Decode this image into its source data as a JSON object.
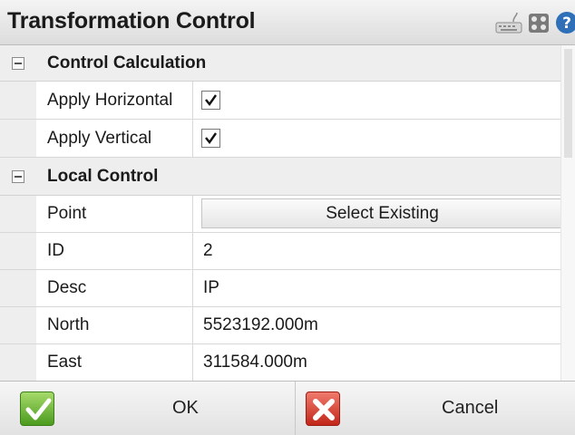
{
  "window": {
    "title": "Transformation Control",
    "icons": [
      "keyboard-icon",
      "grid-icon",
      "help-icon"
    ]
  },
  "sections": {
    "control_calculation": {
      "title": "Control Calculation",
      "apply_horizontal": {
        "label": "Apply Horizontal",
        "checked": true
      },
      "apply_vertical": {
        "label": "Apply Vertical",
        "checked": true
      }
    },
    "local_control": {
      "title": "Local Control",
      "point": {
        "label": "Point",
        "button": "Select Existing"
      },
      "id": {
        "label": "ID",
        "value": "2"
      },
      "desc": {
        "label": "Desc",
        "value": "IP"
      },
      "north": {
        "label": "North",
        "value": "5523192.000m"
      },
      "east": {
        "label": "East",
        "value": "311584.000m"
      }
    }
  },
  "footer": {
    "ok": "OK",
    "cancel": "Cancel"
  },
  "colors": {
    "ok_green": "#4b9b1f",
    "cancel_red": "#c1271a",
    "section_bg": "#eeeeee"
  }
}
